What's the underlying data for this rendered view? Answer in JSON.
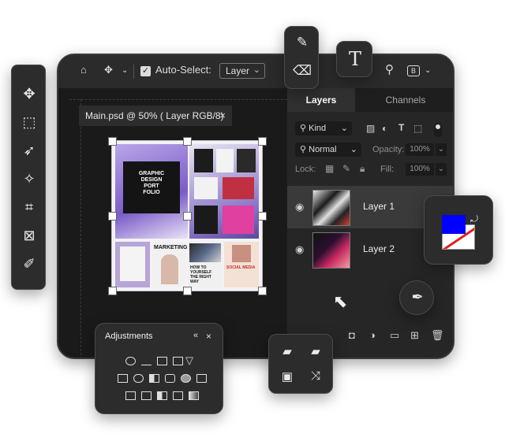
{
  "options_bar": {
    "home_icon": "home-icon",
    "move_icon": "move-icon",
    "auto_select_label": "Auto-Select:",
    "auto_select_checked": true,
    "auto_select_value": "Layer",
    "search_icon": "search-icon",
    "workspace_icon": "workspace-icon"
  },
  "document": {
    "tab_label": "Main.psd @ 50% ( Layer RGB/8)",
    "close_label": "×",
    "artwork": {
      "hero_lines": [
        "GRAPHIC",
        "DESIGN",
        "PORT",
        "FOLIO"
      ],
      "marketing": "MARKETING",
      "how_to": "HOW TO YOURSELF THE RIGHT WAY",
      "social_media": "SOCIAL MEDIA"
    }
  },
  "layers_panel": {
    "tabs": [
      "Layers",
      "Channels"
    ],
    "filter_label": "Kind",
    "blend_mode": "Normal",
    "opacity_label": "Opacity:",
    "opacity_value": "100%",
    "lock_label": "Lock:",
    "fill_label": "Fill:",
    "fill_value": "100%",
    "layers": [
      {
        "name": "Layer 1",
        "selected": true
      },
      {
        "name": "Layer 2",
        "selected": false
      }
    ]
  },
  "adjustments": {
    "title": "Adjustments",
    "collapse_label": "«",
    "close_label": "×"
  },
  "colors": {
    "foreground": "#0000ff",
    "background": "#ffffff",
    "selected_layer_bg": "#3a3a3a",
    "panel_bg": "#262626"
  },
  "tools": [
    "move-icon",
    "marquee-icon",
    "lasso-icon",
    "magic-wand-icon",
    "crop-icon",
    "frame-icon",
    "eyedropper-icon"
  ]
}
